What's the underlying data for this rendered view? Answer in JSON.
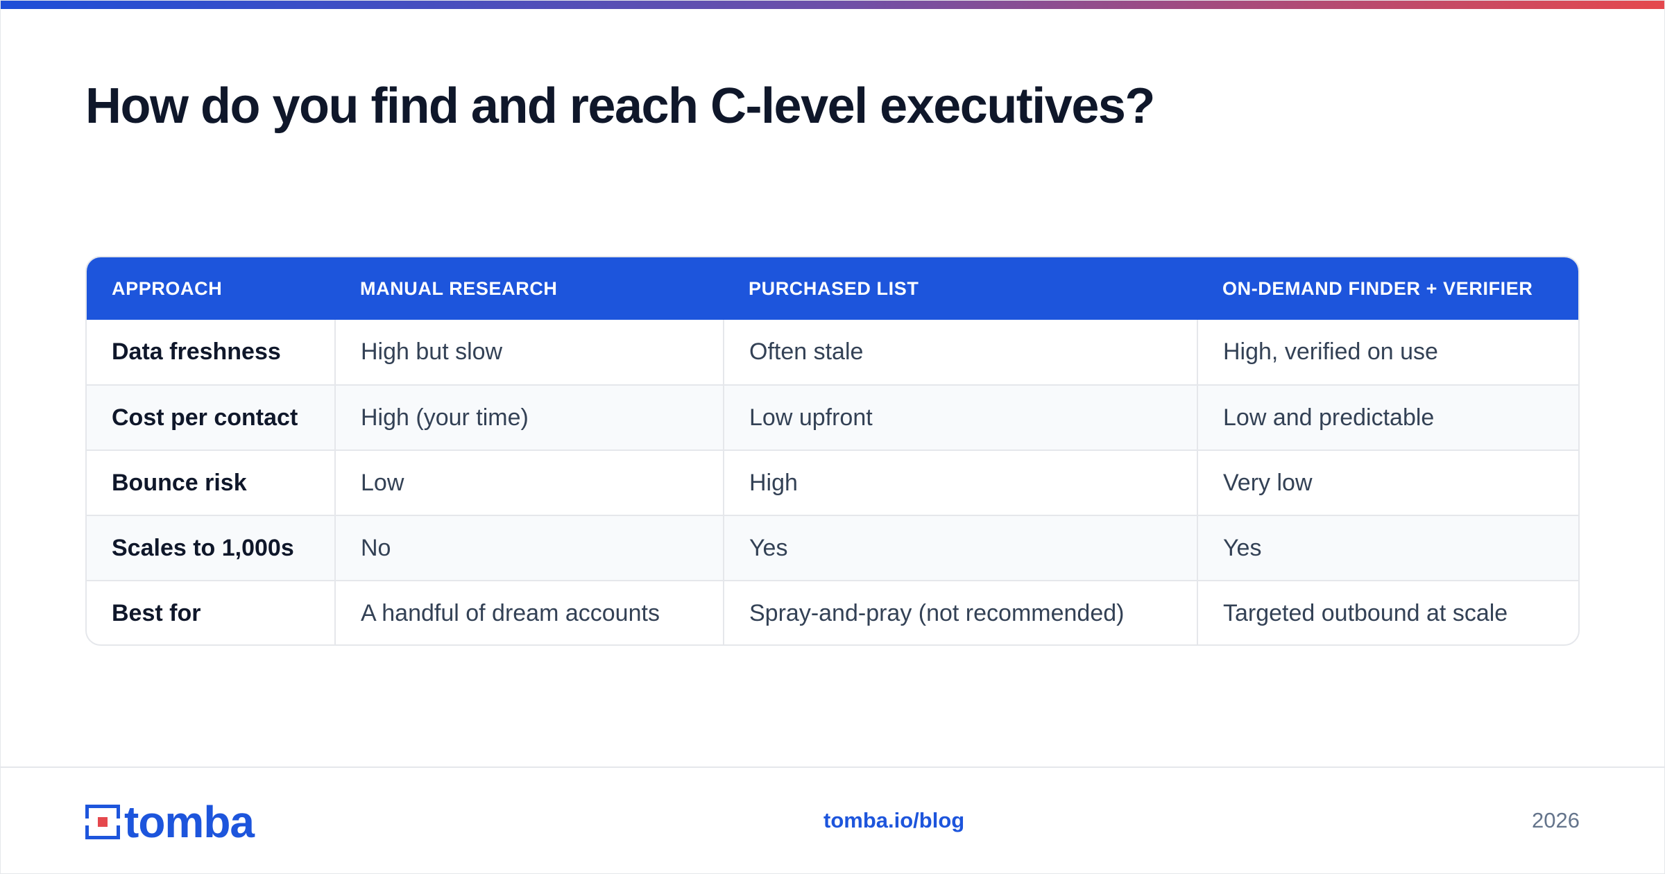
{
  "headline": "How do you find and reach C-level executives?",
  "table": {
    "headers": [
      "APPROACH",
      "MANUAL RESEARCH",
      "PURCHASED LIST",
      "ON-DEMAND FINDER + VERIFIER"
    ],
    "rows": [
      [
        "Data freshness",
        "High but slow",
        "Often stale",
        "High, verified on use"
      ],
      [
        "Cost per contact",
        "High (your time)",
        "Low upfront",
        "Low and predictable"
      ],
      [
        "Bounce risk",
        "Low",
        "High",
        "Very low"
      ],
      [
        "Scales to 1,000s",
        "No",
        "Yes",
        "Yes"
      ],
      [
        "Best for",
        "A handful of dream accounts",
        "Spray-and-pray (not recommended)",
        "Targeted outbound at scale"
      ]
    ]
  },
  "footer": {
    "logo_text": "tomba",
    "link": "tomba.io/blog",
    "year": "2026"
  },
  "colors": {
    "brand_blue": "#1d55dc",
    "logo_accent_red": "#e5484d",
    "headline": "#0f172a"
  },
  "icons": {
    "logo_mark": "tomba-logo-icon"
  }
}
